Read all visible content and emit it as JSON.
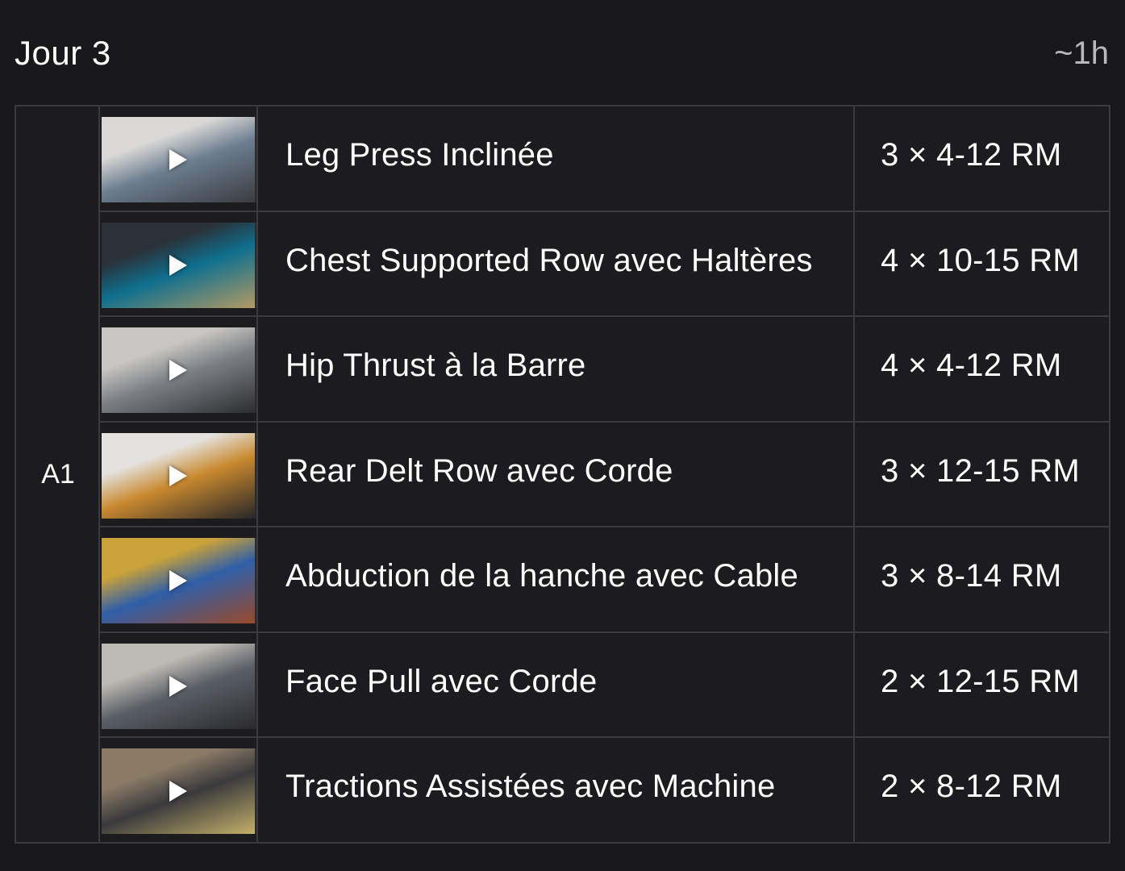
{
  "header": {
    "title": "Jour 3",
    "duration": "~1h"
  },
  "group": {
    "label": "A1"
  },
  "exercises": [
    {
      "name": "Leg Press Inclinée",
      "sets": "3 × 4-12 RM",
      "thumbnail_icon": "play-icon",
      "thumb_colors": [
        "#d9d8d6",
        "#6b7d8f",
        "#3b3c40"
      ]
    },
    {
      "name": "Chest Supported Row avec Haltères",
      "sets": "4 × 10-15 RM",
      "thumbnail_icon": "play-icon",
      "thumb_colors": [
        "#2a3138",
        "#0f6f8f",
        "#b39a63"
      ]
    },
    {
      "name": "Hip Thrust à la Barre",
      "sets": "4 × 4-12 RM",
      "thumbnail_icon": "play-icon",
      "thumb_colors": [
        "#c8c6c2",
        "#7b7f84",
        "#2c2d30"
      ]
    },
    {
      "name": "Rear Delt Row avec Corde",
      "sets": "3 × 12-15 RM",
      "thumbnail_icon": "play-icon",
      "thumb_colors": [
        "#e4e2de",
        "#c9892f",
        "#272628"
      ]
    },
    {
      "name": "Abduction de la hanche avec Cable",
      "sets": "3 × 8-14 RM",
      "thumbnail_icon": "play-icon",
      "thumb_colors": [
        "#c9a23a",
        "#2f5ea8",
        "#9a4a2a"
      ]
    },
    {
      "name": "Face Pull avec Corde",
      "sets": "2 × 12-15 RM",
      "thumbnail_icon": "play-icon",
      "thumb_colors": [
        "#bdb9b3",
        "#5a5f66",
        "#2a2a2d"
      ]
    },
    {
      "name": "Tractions Assistées avec Machine",
      "sets": "2 × 8-12 RM",
      "thumbnail_icon": "play-icon",
      "thumb_colors": [
        "#8a7a66",
        "#3a3a3c",
        "#c4b06a"
      ]
    }
  ]
}
